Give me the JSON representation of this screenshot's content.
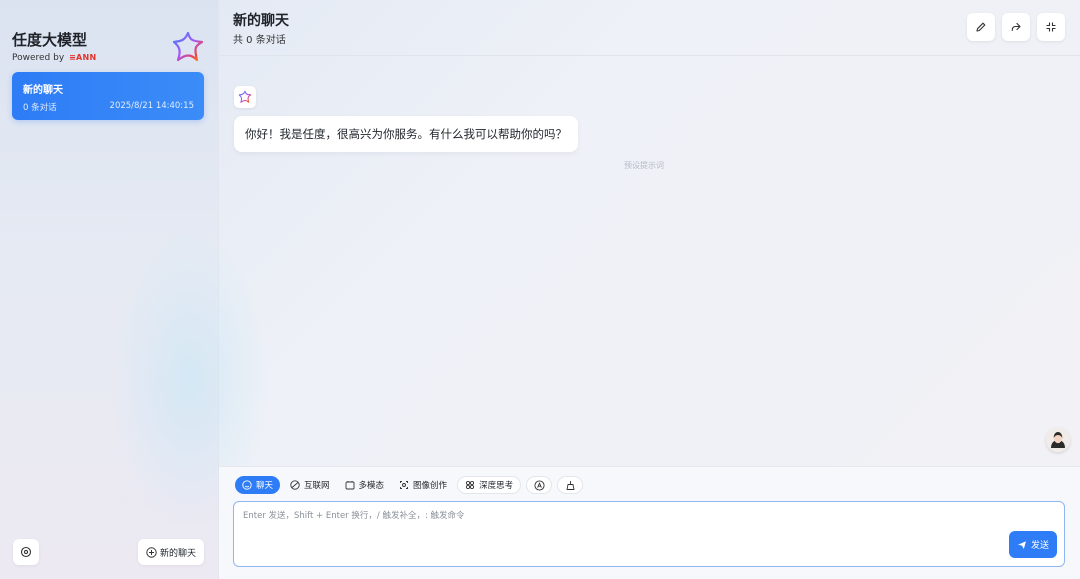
{
  "sidebar": {
    "brand_title": "任度大模型",
    "powered_by": "Powered by",
    "powered_brand": "≡ANN",
    "chat_items": [
      {
        "title": "新的聊天",
        "count": "0 条对话",
        "time": "2025/8/21 14:40:15"
      }
    ],
    "new_chat_label": "新的聊天"
  },
  "header": {
    "title": "新的聊天",
    "subtitle": "共 0 条对话"
  },
  "messages": [
    {
      "role": "bot",
      "text": "你好！我是任度，很高兴为你服务。有什么我可以帮助你的吗？"
    }
  ],
  "preset_hint": "预设提示词",
  "composer": {
    "modes": [
      {
        "label": "聊天",
        "icon": "smile-icon",
        "active": true
      },
      {
        "label": "互联网",
        "icon": "globe-icon",
        "active": false
      },
      {
        "label": "多模态",
        "icon": "multimodal-icon",
        "active": false
      },
      {
        "label": "图像创作",
        "icon": "image-create-icon",
        "active": false
      },
      {
        "label": "深度思考",
        "icon": "deep-think-icon",
        "active": false
      }
    ],
    "placeholder": "Enter 发送，Shift + Enter 换行，/ 触发补全，: 触发命令",
    "send_label": "发送"
  },
  "colors": {
    "accent": "#2e7cf6",
    "input_border": "#8fb6f4"
  }
}
